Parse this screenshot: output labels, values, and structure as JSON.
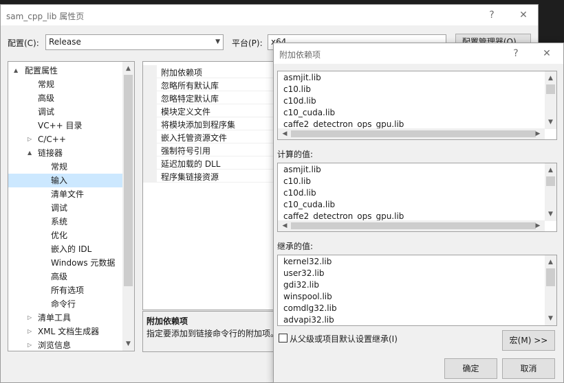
{
  "main_window": {
    "title": "sam_cpp_lib 属性页",
    "help_glyph": "?",
    "close_glyph": "✕",
    "config_label": "配置(C):",
    "config_value": "Release",
    "platform_label": "平台(P):",
    "platform_value": "x64",
    "config_manager_label": "配置管理器(O)..."
  },
  "tree": {
    "items": [
      {
        "label": "配置属性",
        "expander": "▲"
      },
      {
        "label": "常规"
      },
      {
        "label": "高级"
      },
      {
        "label": "调试"
      },
      {
        "label": "VC++ 目录"
      },
      {
        "label": "C/C++",
        "expander": "▷"
      },
      {
        "label": "链接器",
        "expander": "▲"
      },
      {
        "label": "常规"
      },
      {
        "label": "输入",
        "selected": true
      },
      {
        "label": "清单文件"
      },
      {
        "label": "调试"
      },
      {
        "label": "系统"
      },
      {
        "label": "优化"
      },
      {
        "label": "嵌入的 IDL"
      },
      {
        "label": "Windows 元数据"
      },
      {
        "label": "高级"
      },
      {
        "label": "所有选项"
      },
      {
        "label": "命令行"
      },
      {
        "label": "清单工具",
        "expander": "▷"
      },
      {
        "label": "XML 文档生成器",
        "expander": "▷"
      },
      {
        "label": "浏览信息",
        "expander": "▷"
      }
    ]
  },
  "grid": {
    "rows": [
      "附加依赖项",
      "忽略所有默认库",
      "忽略特定默认库",
      "模块定义文件",
      "将模块添加到程序集",
      "嵌入托管资源文件",
      "强制符号引用",
      "延迟加载的 DLL",
      "程序集链接资源"
    ],
    "desc_title": "附加依赖项",
    "desc_text": "指定要添加到链接命令行的附加项。"
  },
  "dialog": {
    "title": "附加依赖项",
    "help_glyph": "?",
    "close_glyph": "✕",
    "edit_lines": [
      "asmjit.lib",
      "c10.lib",
      "c10d.lib",
      "c10_cuda.lib",
      "caffe2_detectron_ops_gpu.lib"
    ],
    "evaluated_label": "计算的值:",
    "evaluated_lines": [
      "asmjit.lib",
      "c10.lib",
      "c10d.lib",
      "c10_cuda.lib",
      "caffe2_detectron_ops_gpu.lib"
    ],
    "inherited_label": "继承的值:",
    "inherited_lines": [
      "kernel32.lib",
      "user32.lib",
      "gdi32.lib",
      "winspool.lib",
      "comdlg32.lib",
      "advapi32.lib"
    ],
    "inherit_checkbox_label": "从父级或项目默认设置继承(I)",
    "macros_button": "宏(M) >>",
    "ok_button": "确定",
    "cancel_button": "取消"
  },
  "colors": {
    "selection": "#cce8ff",
    "window_bg": "#f0f0f0",
    "title_bg": "#ffffff"
  }
}
